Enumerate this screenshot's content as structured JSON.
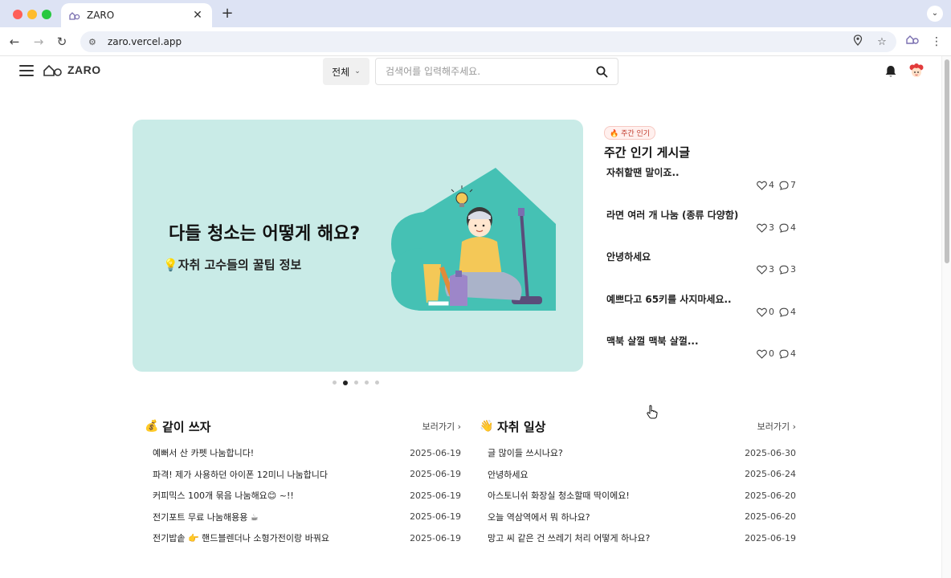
{
  "browser": {
    "tab_title": "ZARO",
    "url": "zaro.vercel.app",
    "new_tab_label": "+"
  },
  "header": {
    "logo_text": "ZARO",
    "category": "전체",
    "search_placeholder": "검색어를 입력해주세요."
  },
  "banner": {
    "title": "다들 청소는 어떻게 해요?",
    "subtitle": "💡자취 고수들의 꿀팁 정보",
    "slide_count": 5,
    "active_slide": 2
  },
  "weekly": {
    "badge": "🔥 주간 인기",
    "title": "주간 인기 게시글",
    "items": [
      {
        "title": "자취할땐 말이죠..",
        "likes": "4",
        "comments": "7"
      },
      {
        "title": "라면 여러 개 나눔 (종류 다양함)",
        "likes": "3",
        "comments": "4"
      },
      {
        "title": "안녕하세요",
        "likes": "3",
        "comments": "3"
      },
      {
        "title": "예쁘다고 65키를 사지마세요..",
        "likes": "0",
        "comments": "4"
      },
      {
        "title": "맥북 살껄 맥북 살껄...",
        "likes": "0",
        "comments": "4"
      }
    ]
  },
  "boards": {
    "share": {
      "icon": "💰",
      "title": "같이 쓰자",
      "more": "보러가기",
      "rows": [
        {
          "title": "예뻐서 산 카펫 나눔합니다!",
          "date": "2025-06-19"
        },
        {
          "title": "파격! 제가 사용하던 아이폰 12미니 나눔합니다",
          "date": "2025-06-19"
        },
        {
          "title": "커피믹스 100개 묶음 나눔해요😊 ~!!",
          "date": "2025-06-19"
        },
        {
          "title": "전기포트 무료 나눔해용용 ☕",
          "date": "2025-06-19"
        },
        {
          "title": "전기밥솥 👉 핸드블렌더나 소형가전이랑 바꿔요",
          "date": "2025-06-19"
        }
      ]
    },
    "daily": {
      "icon": "👋",
      "title": "자취 일상",
      "more": "보러가기",
      "rows": [
        {
          "title": "글 많이들 쓰시나요?",
          "date": "2025-06-30"
        },
        {
          "title": "안녕하세요",
          "date": "2025-06-24"
        },
        {
          "title": "아스토니쉬 화장실 청소할때 딱이에요!",
          "date": "2025-06-20"
        },
        {
          "title": "오늘 역삼역에서 뭐 하나요?",
          "date": "2025-06-20"
        },
        {
          "title": "망고 씨 같은 건 쓰레기 처리 어떻게 하나요?",
          "date": "2025-06-19"
        }
      ]
    }
  },
  "colors": {
    "banner_bg": "#c9ebe7",
    "teal": "#45c1b4",
    "tab_strip": "#dde3f4"
  }
}
